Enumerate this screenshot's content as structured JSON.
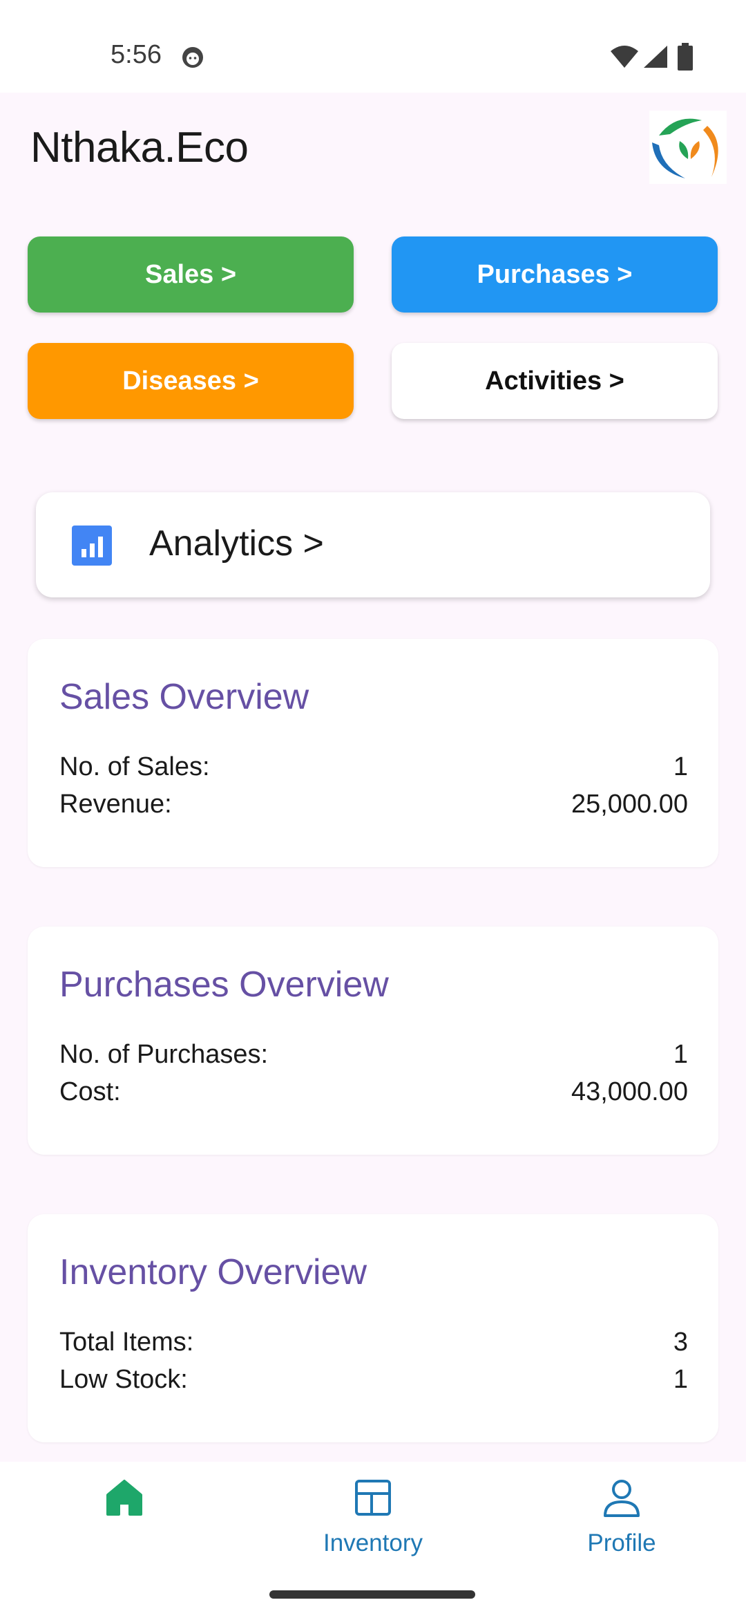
{
  "status_bar": {
    "time": "5:56",
    "icons": [
      "face-icon",
      "wifi-icon",
      "signal-icon",
      "battery-icon"
    ]
  },
  "header": {
    "title": "Nthaka.Eco",
    "logo_icon": "leaf-logo-icon"
  },
  "actions": {
    "sales_label": "Sales >",
    "purchases_label": "Purchases >",
    "diseases_label": "Diseases >",
    "activities_label": "Activities >"
  },
  "analytics": {
    "label": "Analytics >",
    "icon": "bar-chart-icon"
  },
  "sales_overview": {
    "title": "Sales Overview",
    "rows": [
      {
        "label": "No. of Sales:",
        "value": "1"
      },
      {
        "label": "Revenue:",
        "value": "25,000.00"
      }
    ]
  },
  "purchases_overview": {
    "title": "Purchases Overview",
    "rows": [
      {
        "label": "No. of Purchases:",
        "value": "1"
      },
      {
        "label": "Cost:",
        "value": "43,000.00"
      }
    ]
  },
  "inventory_overview": {
    "title": "Inventory Overview",
    "rows": [
      {
        "label": "Total Items:",
        "value": "3"
      },
      {
        "label": "Low Stock:",
        "value": "1"
      }
    ]
  },
  "bottom_nav": {
    "items": [
      {
        "label": "",
        "icon": "home-icon",
        "active": true
      },
      {
        "label": "Inventory",
        "icon": "inventory-grid-icon",
        "active": false
      },
      {
        "label": "Profile",
        "icon": "profile-icon",
        "active": false
      }
    ]
  },
  "colors": {
    "background": "#fdf6fd",
    "sales": "#4caf50",
    "purchases": "#2196f3",
    "diseases": "#ff9800",
    "card_title": "#6650a4",
    "nav_active": "#1ea76a",
    "nav_inactive": "#1f78b4"
  }
}
